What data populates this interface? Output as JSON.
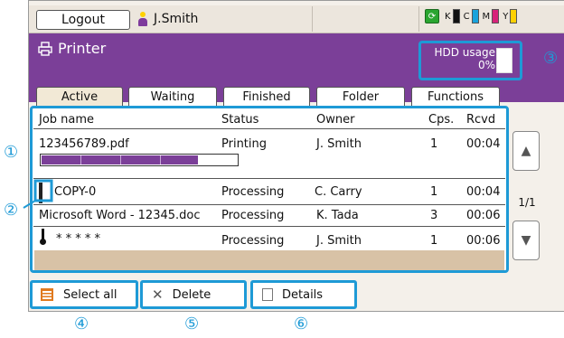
{
  "topbar": {
    "logout_label": "Logout",
    "user_name": "J.Smith",
    "ink_labels": [
      "K",
      "C",
      "M",
      "Y"
    ],
    "ink_colors": [
      "#111111",
      "#19a3dd",
      "#d8237a",
      "#ffd100"
    ]
  },
  "header": {
    "title": "Printer",
    "hdd_label": "HDD usage",
    "hdd_value": "0%"
  },
  "tabs": [
    "Active",
    "Waiting",
    "Finished",
    "Folder",
    "Functions"
  ],
  "jobs": {
    "columns": [
      "Job name",
      "Status",
      "Owner",
      "Cps.",
      "Rcvd"
    ],
    "rows": [
      {
        "name": "123456789.pdf",
        "status": "Printing",
        "owner": "J. Smith",
        "copies": "1",
        "received": "00:04"
      },
      {
        "name": "COPY-0",
        "status": "Processing",
        "owner": "C. Carry",
        "copies": "1",
        "received": "00:04"
      },
      {
        "name": "Microsoft Word - 12345.doc",
        "status": "Processing",
        "owner": "K. Tada",
        "copies": "3",
        "received": "00:06"
      },
      {
        "name": "* * * * *",
        "status": "Processing",
        "owner": "J. Smith",
        "copies": "1",
        "received": "00:06"
      }
    ],
    "progress_fraction": 0.8
  },
  "pager": {
    "page": "1/1",
    "up_symbol": "▲",
    "down_symbol": "▼"
  },
  "actions": {
    "select_all": "Select all",
    "delete": "Delete",
    "details": "Details"
  },
  "callouts": [
    "①",
    "②",
    "③",
    "④",
    "⑤",
    "⑥"
  ]
}
